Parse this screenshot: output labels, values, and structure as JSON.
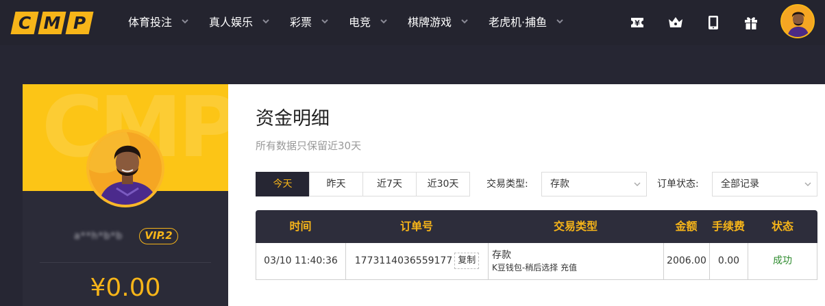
{
  "brand": {
    "logo_letters": [
      "C",
      "M",
      "P"
    ]
  },
  "nav": {
    "items": [
      {
        "label": "体育投注"
      },
      {
        "label": "真人娱乐"
      },
      {
        "label": "彩票"
      },
      {
        "label": "电竞"
      },
      {
        "label": "棋牌游戏"
      },
      {
        "label": "老虎机·捕鱼"
      }
    ],
    "icons": [
      "voucher-icon",
      "crown-icon",
      "tablet-icon",
      "gift-icon"
    ]
  },
  "profile": {
    "banner_watermark": "CMP",
    "username": "a**h*b*b",
    "vip_label": "VIP.2",
    "balance": "¥0.00"
  },
  "main": {
    "title": "资金明细",
    "subtitle": "所有数据只保留近30天",
    "range_tabs": [
      {
        "label": "今天",
        "active": true
      },
      {
        "label": "昨天",
        "active": false
      },
      {
        "label": "近7天",
        "active": false
      },
      {
        "label": "近30天",
        "active": false
      }
    ],
    "filters": {
      "type_label": "交易类型:",
      "type_value": "存款",
      "status_label": "订单状态:",
      "status_value": "全部记录"
    },
    "table": {
      "headers": [
        "时间",
        "订单号",
        "交易类型",
        "金额",
        "手续费",
        "状态"
      ],
      "rows": [
        {
          "time": "03/10 11:40:36",
          "order_no": "1773114036559177",
          "copy_label": "复制",
          "type_main": "存款",
          "type_detail": "K豆钱包-稍后选择 充值",
          "amount": "2006.00",
          "fee": "0.00",
          "status": "成功"
        }
      ]
    }
  },
  "colors": {
    "accent": "#f7b519",
    "nav_bg": "#24242f",
    "page_bg": "#262633",
    "success": "#2e8b2e"
  }
}
